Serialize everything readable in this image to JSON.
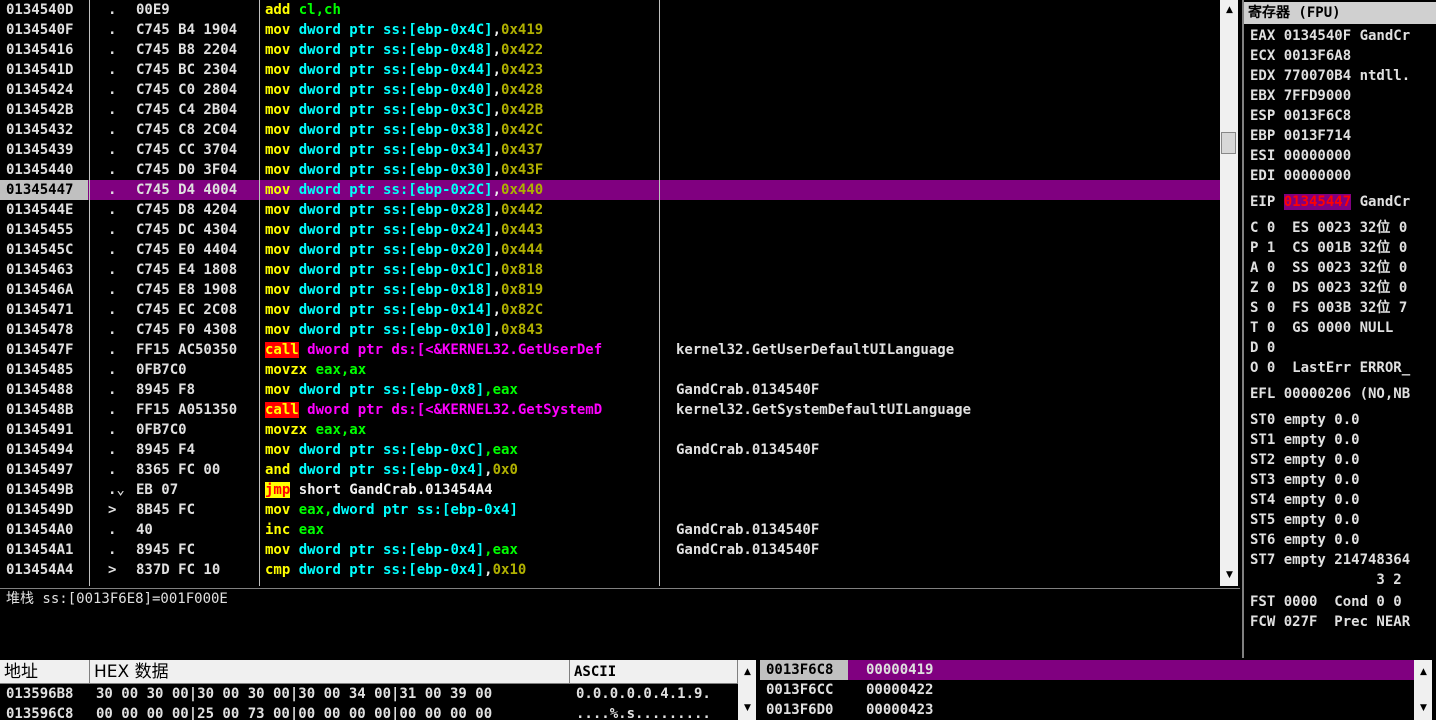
{
  "disasm": {
    "rows": [
      {
        "addr": "0134540D",
        "mark": ".",
        "hex": "00E9",
        "ins": [
          [
            "add",
            "yellow"
          ],
          [
            " cl,ch",
            "green"
          ]
        ],
        "cmt": ""
      },
      {
        "addr": "0134540F",
        "mark": ".",
        "hex": "C745 B4 1904",
        "ins": [
          [
            "mov",
            "yellow"
          ],
          [
            " dword ptr ss:[ebp-0x4C]",
            "cyan"
          ],
          [
            ",",
            "white"
          ],
          [
            "0x419",
            "olive"
          ]
        ],
        "cmt": ""
      },
      {
        "addr": "01345416",
        "mark": ".",
        "hex": "C745 B8 2204",
        "ins": [
          [
            "mov",
            "yellow"
          ],
          [
            " dword ptr ss:[ebp-0x48]",
            "cyan"
          ],
          [
            ",",
            "white"
          ],
          [
            "0x422",
            "olive"
          ]
        ],
        "cmt": ""
      },
      {
        "addr": "0134541D",
        "mark": ".",
        "hex": "C745 BC 2304",
        "ins": [
          [
            "mov",
            "yellow"
          ],
          [
            " dword ptr ss:[ebp-0x44]",
            "cyan"
          ],
          [
            ",",
            "white"
          ],
          [
            "0x423",
            "olive"
          ]
        ],
        "cmt": ""
      },
      {
        "addr": "01345424",
        "mark": ".",
        "hex": "C745 C0 2804",
        "ins": [
          [
            "mov",
            "yellow"
          ],
          [
            " dword ptr ss:[ebp-0x40]",
            "cyan"
          ],
          [
            ",",
            "white"
          ],
          [
            "0x428",
            "olive"
          ]
        ],
        "cmt": ""
      },
      {
        "addr": "0134542B",
        "mark": ".",
        "hex": "C745 C4 2B04",
        "ins": [
          [
            "mov",
            "yellow"
          ],
          [
            " dword ptr ss:[ebp-0x3C]",
            "cyan"
          ],
          [
            ",",
            "white"
          ],
          [
            "0x42B",
            "olive"
          ]
        ],
        "cmt": ""
      },
      {
        "addr": "01345432",
        "mark": ".",
        "hex": "C745 C8 2C04",
        "ins": [
          [
            "mov",
            "yellow"
          ],
          [
            " dword ptr ss:[ebp-0x38]",
            "cyan"
          ],
          [
            ",",
            "white"
          ],
          [
            "0x42C",
            "olive"
          ]
        ],
        "cmt": ""
      },
      {
        "addr": "01345439",
        "mark": ".",
        "hex": "C745 CC 3704",
        "ins": [
          [
            "mov",
            "yellow"
          ],
          [
            " dword ptr ss:[ebp-0x34]",
            "cyan"
          ],
          [
            ",",
            "white"
          ],
          [
            "0x437",
            "olive"
          ]
        ],
        "cmt": ""
      },
      {
        "addr": "01345440",
        "mark": ".",
        "hex": "C745 D0 3F04",
        "ins": [
          [
            "mov",
            "yellow"
          ],
          [
            " dword ptr ss:[ebp-0x30]",
            "cyan"
          ],
          [
            ",",
            "white"
          ],
          [
            "0x43F",
            "olive"
          ]
        ],
        "cmt": ""
      },
      {
        "addr": "01345447",
        "mark": ".",
        "hex": "C745 D4 4004",
        "ins": [
          [
            "mov",
            "yellow"
          ],
          [
            " dword ptr ss:[ebp-0x2C]",
            "cyan"
          ],
          [
            ",",
            "white"
          ],
          [
            "0x440",
            "olive"
          ]
        ],
        "cmt": "",
        "sel": true
      },
      {
        "addr": "0134544E",
        "mark": ".",
        "hex": "C745 D8 4204",
        "ins": [
          [
            "mov",
            "yellow"
          ],
          [
            " dword ptr ss:[ebp-0x28]",
            "cyan"
          ],
          [
            ",",
            "white"
          ],
          [
            "0x442",
            "olive"
          ]
        ],
        "cmt": ""
      },
      {
        "addr": "01345455",
        "mark": ".",
        "hex": "C745 DC 4304",
        "ins": [
          [
            "mov",
            "yellow"
          ],
          [
            " dword ptr ss:[ebp-0x24]",
            "cyan"
          ],
          [
            ",",
            "white"
          ],
          [
            "0x443",
            "olive"
          ]
        ],
        "cmt": ""
      },
      {
        "addr": "0134545C",
        "mark": ".",
        "hex": "C745 E0 4404",
        "ins": [
          [
            "mov",
            "yellow"
          ],
          [
            " dword ptr ss:[ebp-0x20]",
            "cyan"
          ],
          [
            ",",
            "white"
          ],
          [
            "0x444",
            "olive"
          ]
        ],
        "cmt": ""
      },
      {
        "addr": "01345463",
        "mark": ".",
        "hex": "C745 E4 1808",
        "ins": [
          [
            "mov",
            "yellow"
          ],
          [
            " dword ptr ss:[ebp-0x1C]",
            "cyan"
          ],
          [
            ",",
            "white"
          ],
          [
            "0x818",
            "olive"
          ]
        ],
        "cmt": ""
      },
      {
        "addr": "0134546A",
        "mark": ".",
        "hex": "C745 E8 1908",
        "ins": [
          [
            "mov",
            "yellow"
          ],
          [
            " dword ptr ss:[ebp-0x18]",
            "cyan"
          ],
          [
            ",",
            "white"
          ],
          [
            "0x819",
            "olive"
          ]
        ],
        "cmt": ""
      },
      {
        "addr": "01345471",
        "mark": ".",
        "hex": "C745 EC 2C08",
        "ins": [
          [
            "mov",
            "yellow"
          ],
          [
            " dword ptr ss:[ebp-0x14]",
            "cyan"
          ],
          [
            ",",
            "white"
          ],
          [
            "0x82C",
            "olive"
          ]
        ],
        "cmt": ""
      },
      {
        "addr": "01345478",
        "mark": ".",
        "hex": "C745 F0 4308",
        "ins": [
          [
            "mov",
            "yellow"
          ],
          [
            " dword ptr ss:[ebp-0x10]",
            "cyan"
          ],
          [
            ",",
            "white"
          ],
          [
            "0x843",
            "olive"
          ]
        ],
        "cmt": ""
      },
      {
        "addr": "0134547F",
        "mark": ".",
        "hex": "FF15 AC50350",
        "ins": [
          [
            "call",
            "redbg"
          ],
          [
            " dword ptr ds:[<&KERNEL32.GetUserDef",
            "magenta"
          ]
        ],
        "cmt": "kernel32.GetUserDefaultUILanguage"
      },
      {
        "addr": "01345485",
        "mark": ".",
        "hex": "0FB7C0",
        "ins": [
          [
            "movzx",
            "yellow"
          ],
          [
            " eax,ax",
            "green"
          ]
        ],
        "cmt": ""
      },
      {
        "addr": "01345488",
        "mark": ".",
        "hex": "8945 F8",
        "ins": [
          [
            "mov",
            "yellow"
          ],
          [
            " dword ptr ss:[ebp-0x8]",
            "cyan"
          ],
          [
            ",eax",
            "green"
          ]
        ],
        "cmt": "GandCrab.0134540F"
      },
      {
        "addr": "0134548B",
        "mark": ".",
        "hex": "FF15 A051350",
        "ins": [
          [
            "call",
            "redbg"
          ],
          [
            " dword ptr ds:[<&KERNEL32.GetSystemD",
            "magenta"
          ]
        ],
        "cmt": "kernel32.GetSystemDefaultUILanguage"
      },
      {
        "addr": "01345491",
        "mark": ".",
        "hex": "0FB7C0",
        "ins": [
          [
            "movzx",
            "yellow"
          ],
          [
            " eax,ax",
            "green"
          ]
        ],
        "cmt": ""
      },
      {
        "addr": "01345494",
        "mark": ".",
        "hex": "8945 F4",
        "ins": [
          [
            "mov",
            "yellow"
          ],
          [
            " dword ptr ss:[ebp-0xC]",
            "cyan"
          ],
          [
            ",eax",
            "green"
          ]
        ],
        "cmt": "GandCrab.0134540F"
      },
      {
        "addr": "01345497",
        "mark": ".",
        "hex": "8365 FC 00",
        "ins": [
          [
            "and",
            "yellow"
          ],
          [
            " dword ptr ss:[ebp-0x4]",
            "cyan"
          ],
          [
            ",",
            "white"
          ],
          [
            "0x0",
            "olive"
          ]
        ],
        "cmt": ""
      },
      {
        "addr": "0134549B",
        "mark": ".⌄",
        "hex": "EB 07",
        "ins": [
          [
            "jmp",
            "yelbg"
          ],
          [
            " short GandCrab.013454A4",
            "white"
          ]
        ],
        "cmt": ""
      },
      {
        "addr": "0134549D",
        "mark": ">",
        "hex": "8B45 FC",
        "ins": [
          [
            "mov",
            "yellow"
          ],
          [
            " eax,",
            "green"
          ],
          [
            "dword ptr ss:[ebp-0x4]",
            "cyan"
          ]
        ],
        "cmt": ""
      },
      {
        "addr": "013454A0",
        "mark": ".",
        "hex": "40",
        "ins": [
          [
            "inc",
            "yellow"
          ],
          [
            " eax",
            "green"
          ]
        ],
        "cmt": "GandCrab.0134540F"
      },
      {
        "addr": "013454A1",
        "mark": ".",
        "hex": "8945 FC",
        "ins": [
          [
            "mov",
            "yellow"
          ],
          [
            " dword ptr ss:[ebp-0x4]",
            "cyan"
          ],
          [
            ",eax",
            "green"
          ]
        ],
        "cmt": "GandCrab.0134540F"
      },
      {
        "addr": "013454A4",
        "mark": ">",
        "hex": "837D FC 10",
        "ins": [
          [
            "cmp",
            "yellow"
          ],
          [
            " dword ptr ss:[ebp-0x4]",
            "cyan"
          ],
          [
            ",",
            "white"
          ],
          [
            "0x10",
            "olive"
          ]
        ],
        "cmt": ""
      }
    ]
  },
  "info_pane": {
    "text": "堆栈 ss:[0013F6E8]=001F000E"
  },
  "registers": {
    "title": "寄存器 (FPU)",
    "rows": [
      {
        "text": "EAX 0134540F GandCr"
      },
      {
        "text": "ECX 0013F6A8"
      },
      {
        "text": "EDX 770070B4 ntdll."
      },
      {
        "text": "EBX 7FFD9000"
      },
      {
        "text": "ESP 0013F6C8"
      },
      {
        "text": "EBP 0013F714"
      },
      {
        "text": "ESI 00000000"
      },
      {
        "text": "EDI 00000000"
      },
      {
        "eip": true,
        "label": "EIP ",
        "value": "01345447",
        "rest": " GandCr"
      },
      {
        "text": "C 0  ES 0023 32位 0"
      },
      {
        "text": "P 1  CS 001B 32位 0"
      },
      {
        "text": "A 0  SS 0023 32位 0"
      },
      {
        "text": "Z 0  DS 0023 32位 0"
      },
      {
        "text": "S 0  FS 003B 32位 7"
      },
      {
        "text": "T 0  GS 0000 NULL"
      },
      {
        "text": "D 0"
      },
      {
        "text": "O 0  LastErr ERROR_"
      },
      {
        "text": "EFL 00000206 (NO,NB"
      },
      {
        "text": "ST0 empty 0.0"
      },
      {
        "text": "ST1 empty 0.0"
      },
      {
        "text": "ST2 empty 0.0"
      },
      {
        "text": "ST3 empty 0.0"
      },
      {
        "text": "ST4 empty 0.0"
      },
      {
        "text": "ST5 empty 0.0"
      },
      {
        "text": "ST6 empty 0.0"
      },
      {
        "text": "ST7 empty 214748364"
      },
      {
        "text": "               3 2"
      },
      {
        "text": "FST 0000  Cond 0 0"
      },
      {
        "text": "FCW 027F  Prec NEAR"
      }
    ]
  },
  "dump": {
    "headers": {
      "addr": "地址",
      "hex": "HEX 数据",
      "ascii": "ASCII"
    },
    "rows": [
      {
        "addr": "013596B8",
        "hex": "30 00 30 00|30 00 30 00|30 00 34 00|31 00 39 00",
        "ascii": "0.0.0.0.0.4.1.9."
      },
      {
        "addr": "013596C8",
        "hex": "00 00 00 00|25 00 73 00|00 00 00 00|00 00 00 00",
        "ascii": "....%.s........."
      }
    ]
  },
  "stack": {
    "rows": [
      {
        "addr": "0013F6C8",
        "val": "00000419",
        "sel": true
      },
      {
        "addr": "0013F6CC",
        "val": "00000422"
      },
      {
        "addr": "0013F6D0",
        "val": "00000423"
      }
    ]
  },
  "icons": {
    "up": "triangle-up",
    "down": "triangle-down"
  },
  "colors": {
    "highlight": "#800080",
    "background": "#000000"
  }
}
